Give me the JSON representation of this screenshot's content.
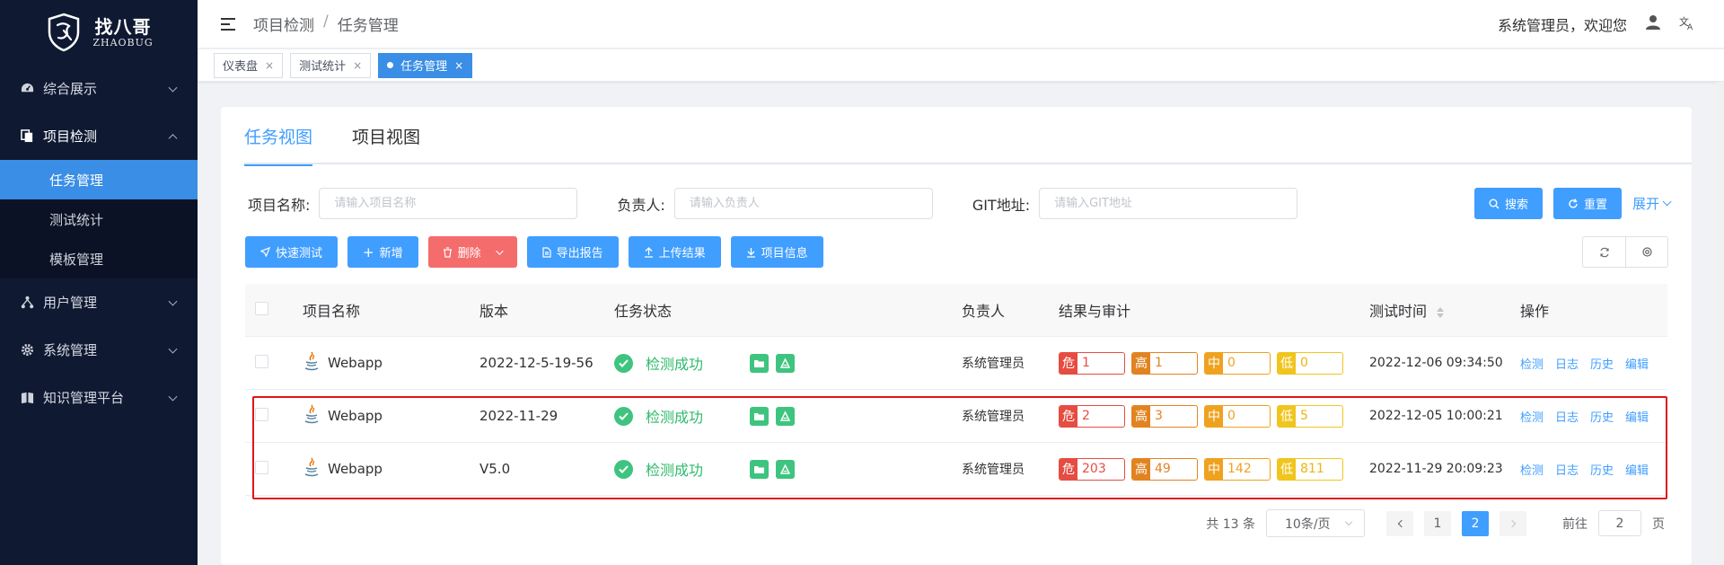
{
  "logo": {
    "cn": "找八哥",
    "en": "ZHAOBUG"
  },
  "sidebar": {
    "items": [
      {
        "label": "综合展示",
        "icon": "dashboard-icon"
      },
      {
        "label": "项目检测",
        "icon": "copy-icon",
        "open": true,
        "children": [
          {
            "label": "任务管理",
            "active": true
          },
          {
            "label": "测试统计"
          },
          {
            "label": "模板管理"
          }
        ]
      },
      {
        "label": "用户管理",
        "icon": "tree-icon"
      },
      {
        "label": "系统管理",
        "icon": "gear-icon"
      },
      {
        "label": "知识管理平台",
        "icon": "book-icon"
      }
    ]
  },
  "header": {
    "breadcrumb": [
      "项目检测",
      "任务管理"
    ],
    "breadcrumb_sep": "/",
    "welcome": "系统管理员，欢迎您"
  },
  "tags": [
    {
      "label": "仪表盘"
    },
    {
      "label": "测试统计"
    },
    {
      "label": "任务管理",
      "active": true
    }
  ],
  "tabs": [
    "任务视图",
    "项目视图"
  ],
  "filters": {
    "project_label": "项目名称:",
    "project_placeholder": "请输入项目名称",
    "owner_label": "负责人:",
    "owner_placeholder": "请输入负责人",
    "git_label": "GIT地址:",
    "git_placeholder": "请输入GIT地址",
    "search": "搜索",
    "reset": "重置",
    "expand": "展开"
  },
  "toolbar": {
    "quick_test": "快速测试",
    "add": "新增",
    "delete": "删除",
    "export": "导出报告",
    "upload": "上传结果",
    "project_info": "项目信息"
  },
  "table": {
    "headers": {
      "name": "项目名称",
      "version": "版本",
      "status": "任务状态",
      "owner": "负责人",
      "result": "结果与审计",
      "time": "测试时间",
      "ops": "操作"
    },
    "severity_keys": {
      "crit": "危",
      "high": "高",
      "mid": "中",
      "low": "低"
    },
    "ops_labels": {
      "detect": "检测",
      "log": "日志",
      "history": "历史",
      "edit": "编辑"
    },
    "rows": [
      {
        "name": "Webapp",
        "version": "2022-12-5-19-56",
        "status": "检测成功",
        "owner": "系统管理员",
        "crit": "1",
        "high": "1",
        "mid": "0",
        "low": "0",
        "time": "2022-12-06 09:34:50"
      },
      {
        "name": "Webapp",
        "version": "2022-11-29",
        "status": "检测成功",
        "owner": "系统管理员",
        "crit": "2",
        "high": "3",
        "mid": "0",
        "low": "5",
        "time": "2022-12-05 10:00:21"
      },
      {
        "name": "Webapp",
        "version": "V5.0",
        "status": "检测成功",
        "owner": "系统管理员",
        "crit": "203",
        "high": "49",
        "mid": "142",
        "low": "811",
        "time": "2022-11-29 20:09:23"
      }
    ]
  },
  "pagination": {
    "total": "共 13 条",
    "page_size": "10条/页",
    "pages": [
      "1",
      "2"
    ],
    "current": "2",
    "goto_label": "前往",
    "goto_value": "2",
    "page_unit": "页"
  },
  "colors": {
    "primary": "#409eff",
    "sidebar": "#0f1932",
    "success": "#3ec47f",
    "danger": "#f56c6c",
    "highlight": "#e0151b"
  }
}
